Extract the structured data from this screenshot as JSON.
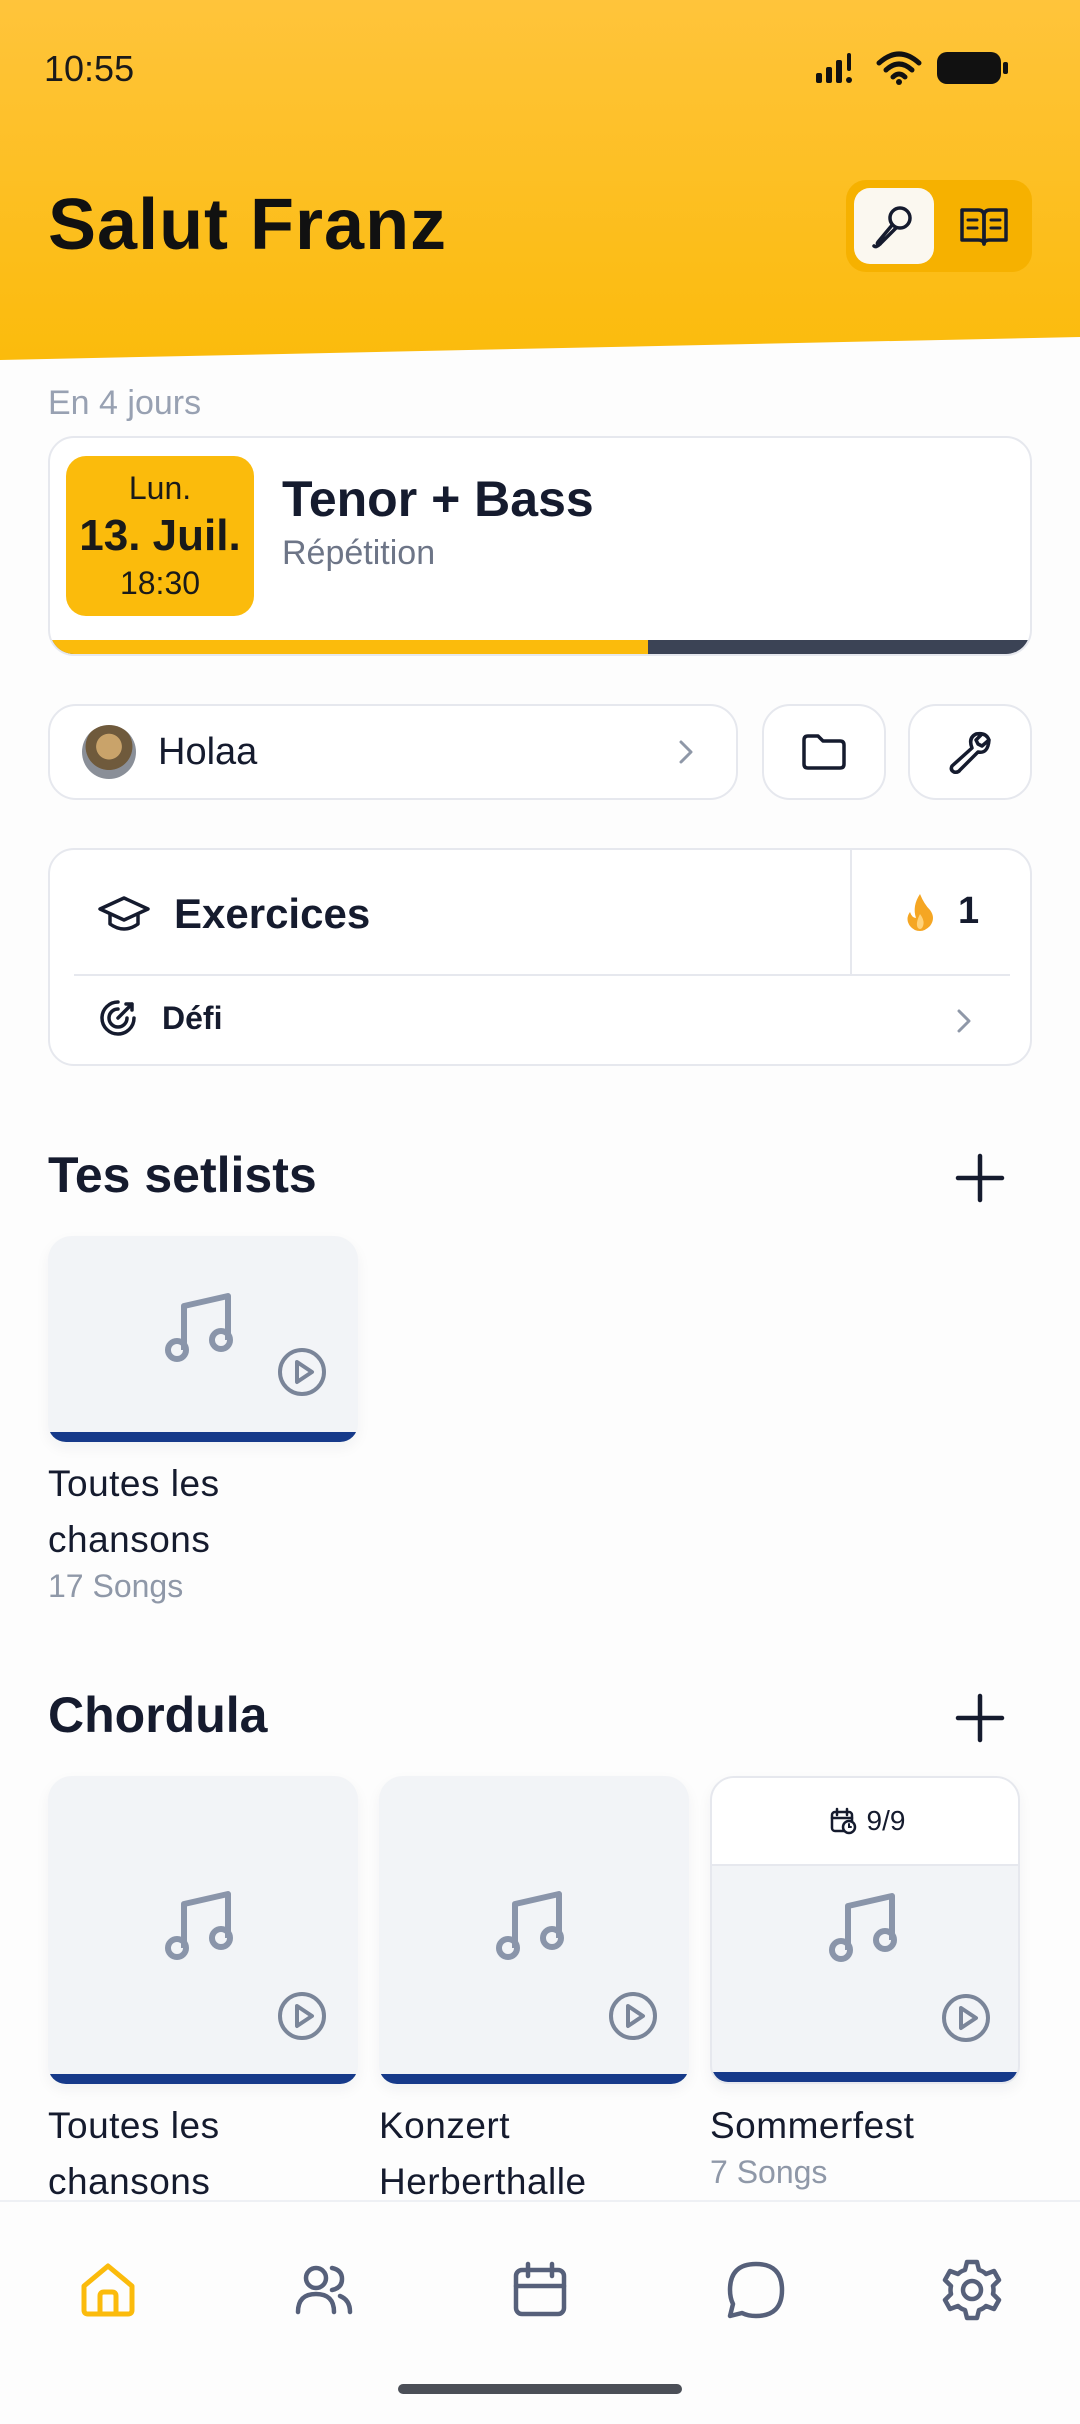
{
  "status_bar": {
    "time": "10:55"
  },
  "header": {
    "greeting": "Salut Franz",
    "accent_color": "#fbbb0c",
    "mode_toggle": [
      {
        "icon": "microphone-icon",
        "active": true
      },
      {
        "icon": "open-book-icon",
        "active": false
      }
    ]
  },
  "next_event": {
    "eyebrow": "En 4 jours",
    "day_of_week": "Lun.",
    "date": "13. Juil.",
    "time": "18:30",
    "title": "Tenor + Bass",
    "subtitle": "Répétition",
    "progress_fraction": 0.61
  },
  "group": {
    "name": "Holaa"
  },
  "exercises": {
    "title": "Exercices",
    "streak_count": "1",
    "challenge_label": "Défi"
  },
  "my_setlists": {
    "title": "Tes setlists",
    "items": [
      {
        "name": "Toutes les chansons",
        "count": "17 Songs"
      }
    ]
  },
  "band": {
    "title": "Chordula",
    "items": [
      {
        "name": "Toutes les chansons",
        "count": ""
      },
      {
        "name": "Konzert Herberthalle",
        "count": ""
      },
      {
        "name": "Sommerfest",
        "count": "7 Songs",
        "badge": "9/9"
      }
    ]
  },
  "tabbar": {
    "active": "home",
    "active_color": "#fbbb0c",
    "tabs": [
      "home-icon",
      "people-icon",
      "calendar-icon",
      "chat-icon",
      "settings-icon"
    ]
  }
}
